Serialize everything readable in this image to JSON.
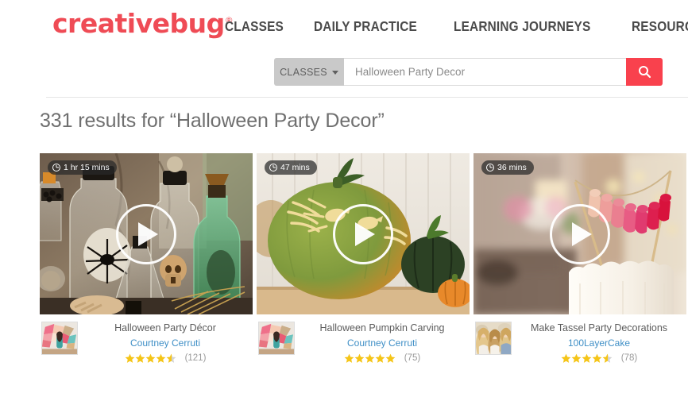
{
  "brand": {
    "logo_text": "creativebug",
    "trademark": "®",
    "accent_color": "#ef4b55",
    "search_button_color": "#f9414d"
  },
  "nav": {
    "items": [
      {
        "label": "CLASSES"
      },
      {
        "label": "DAILY PRACTICE"
      },
      {
        "label": "LEARNING JOURNEYS"
      },
      {
        "label": "RESOURCES"
      }
    ]
  },
  "search": {
    "category_label": "CLASSES",
    "query_value": "Halloween Party Decor",
    "placeholder": "Halloween Party Decor",
    "search_icon": "search-icon",
    "dropdown_icon": "chevron-down-icon"
  },
  "results": {
    "heading": "331 results for “Halloween Party Decor”",
    "count": 331,
    "query": "Halloween Party Decor"
  },
  "cards": [
    {
      "duration": "1 hr 15 mins",
      "title": "Halloween Party Décor",
      "author": "Courtney Cerruti",
      "rating": 4.5,
      "review_count": "(121)",
      "play_icon": "play-icon",
      "clock_icon": "clock-icon",
      "thumb_alt": "halloween-apothecary-bottles-scene",
      "avatar_alt": "courtney-cerruti-avatar"
    },
    {
      "duration": "47 mins",
      "title": "Halloween Pumpkin Carving",
      "author": "Courtney Cerruti",
      "rating": 5,
      "review_count": "(75)",
      "play_icon": "play-icon",
      "clock_icon": "clock-icon",
      "thumb_alt": "carved-green-pumpkin-with-birds",
      "avatar_alt": "courtney-cerruti-avatar"
    },
    {
      "duration": "36 mins",
      "title": "Make Tassel Party Decorations",
      "author": "100LayerCake",
      "rating": 4.5,
      "review_count": "(78)",
      "play_icon": "play-icon",
      "clock_icon": "clock-icon",
      "thumb_alt": "white-cake-with-tassel-garland-topper",
      "avatar_alt": "100layercake-team-avatar"
    }
  ]
}
